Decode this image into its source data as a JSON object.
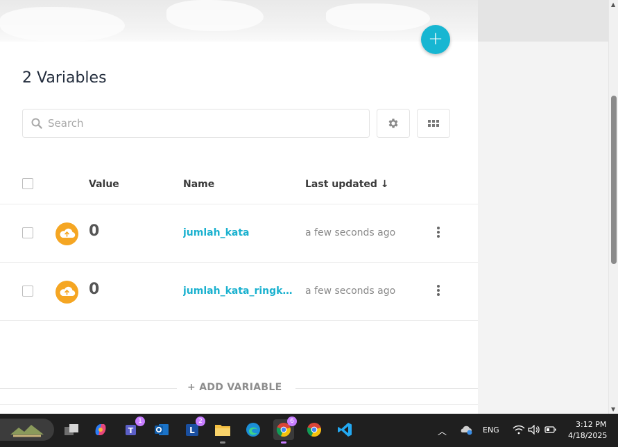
{
  "page": {
    "title": "2 Variables",
    "fab_label": "+"
  },
  "search": {
    "placeholder": "Search"
  },
  "table": {
    "columns": [
      "Value",
      "Name",
      "Last updated ↓"
    ],
    "rows": [
      {
        "value": "0",
        "name": "jumlah_kata",
        "updated": "a few seconds ago"
      },
      {
        "value": "0",
        "name": "jumlah_kata_ringka...",
        "updated": "a few seconds ago"
      }
    ]
  },
  "add_variable": {
    "label": "+ ADD VARIABLE"
  },
  "taskbar": {
    "language": "ENG",
    "time": "3:12 PM",
    "date": "4/18/2025",
    "badges": {
      "teams": "1",
      "l_app": "2",
      "chrome": "6"
    }
  },
  "colors": {
    "accent": "#17b6d2",
    "link": "#1ab1cf",
    "cloud": "#f5a623",
    "title": "#222c3c"
  }
}
